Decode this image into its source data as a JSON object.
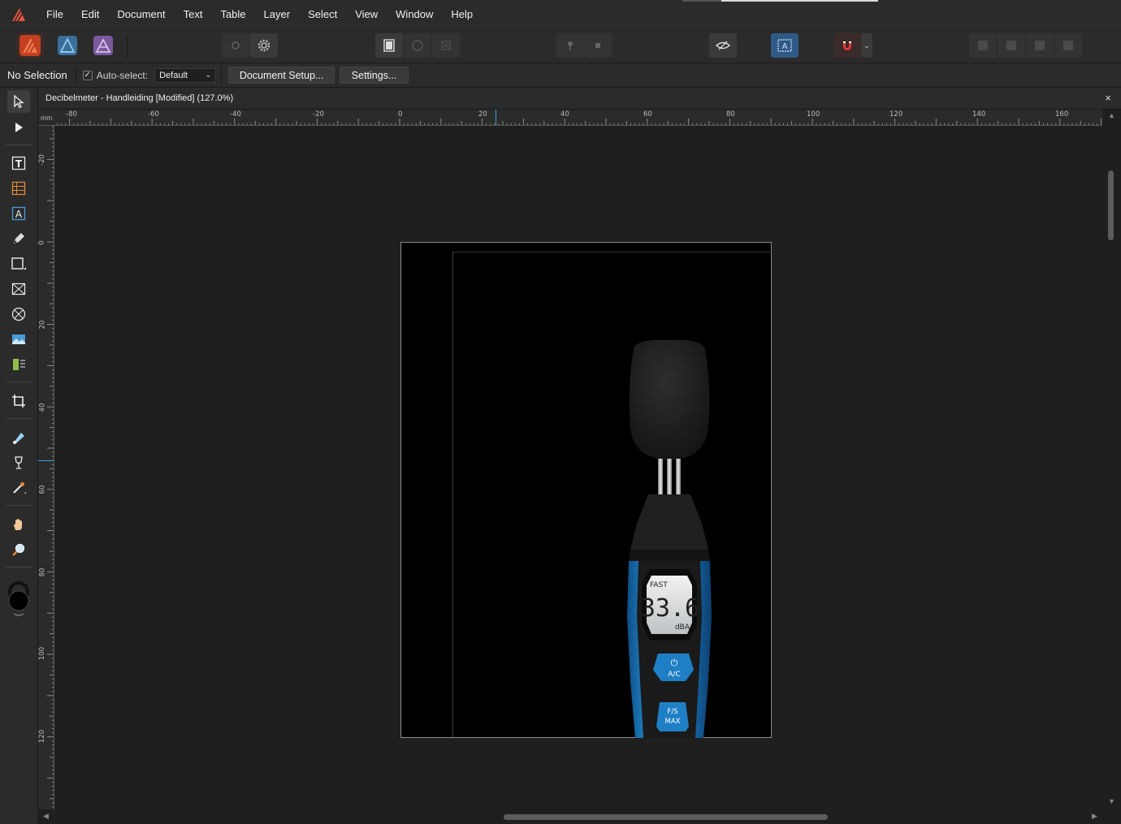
{
  "menu": [
    "File",
    "Edit",
    "Document",
    "Text",
    "Table",
    "Layer",
    "Select",
    "View",
    "Window",
    "Help"
  ],
  "context": {
    "selection": "No Selection",
    "auto_select_label": "Auto-select:",
    "auto_select_value": "Default",
    "auto_select_checked": true,
    "document_setup": "Document Setup...",
    "settings": "Settings..."
  },
  "document": {
    "title": "Decibelmeter - Handleiding [Modified] (127.0%)",
    "close": "×"
  },
  "ruler": {
    "unit": "mm",
    "h_ticks": [
      "-80",
      "-60",
      "-40",
      "-20",
      "0",
      "20",
      "40",
      "60",
      "80",
      "100",
      "120",
      "140",
      "160"
    ],
    "v_ticks": [
      "-20",
      "0",
      "20",
      "40",
      "60",
      "80",
      "100",
      "120"
    ]
  },
  "device": {
    "mode": "FAST",
    "reading": "33.6",
    "unit": "dBA",
    "button1": "A/C",
    "button2_line1": "F/S",
    "button2_line2": "MAX"
  },
  "colors": {
    "accent_blue": "#3aa0e0",
    "device_blue": "#1e7fc4",
    "brand_orange": "#e8553a"
  },
  "icons": {
    "app": "affinity-publisher-logo",
    "persona_publisher": "publisher-persona-icon",
    "persona_designer": "designer-persona-icon",
    "persona_photo": "photo-persona-icon"
  }
}
